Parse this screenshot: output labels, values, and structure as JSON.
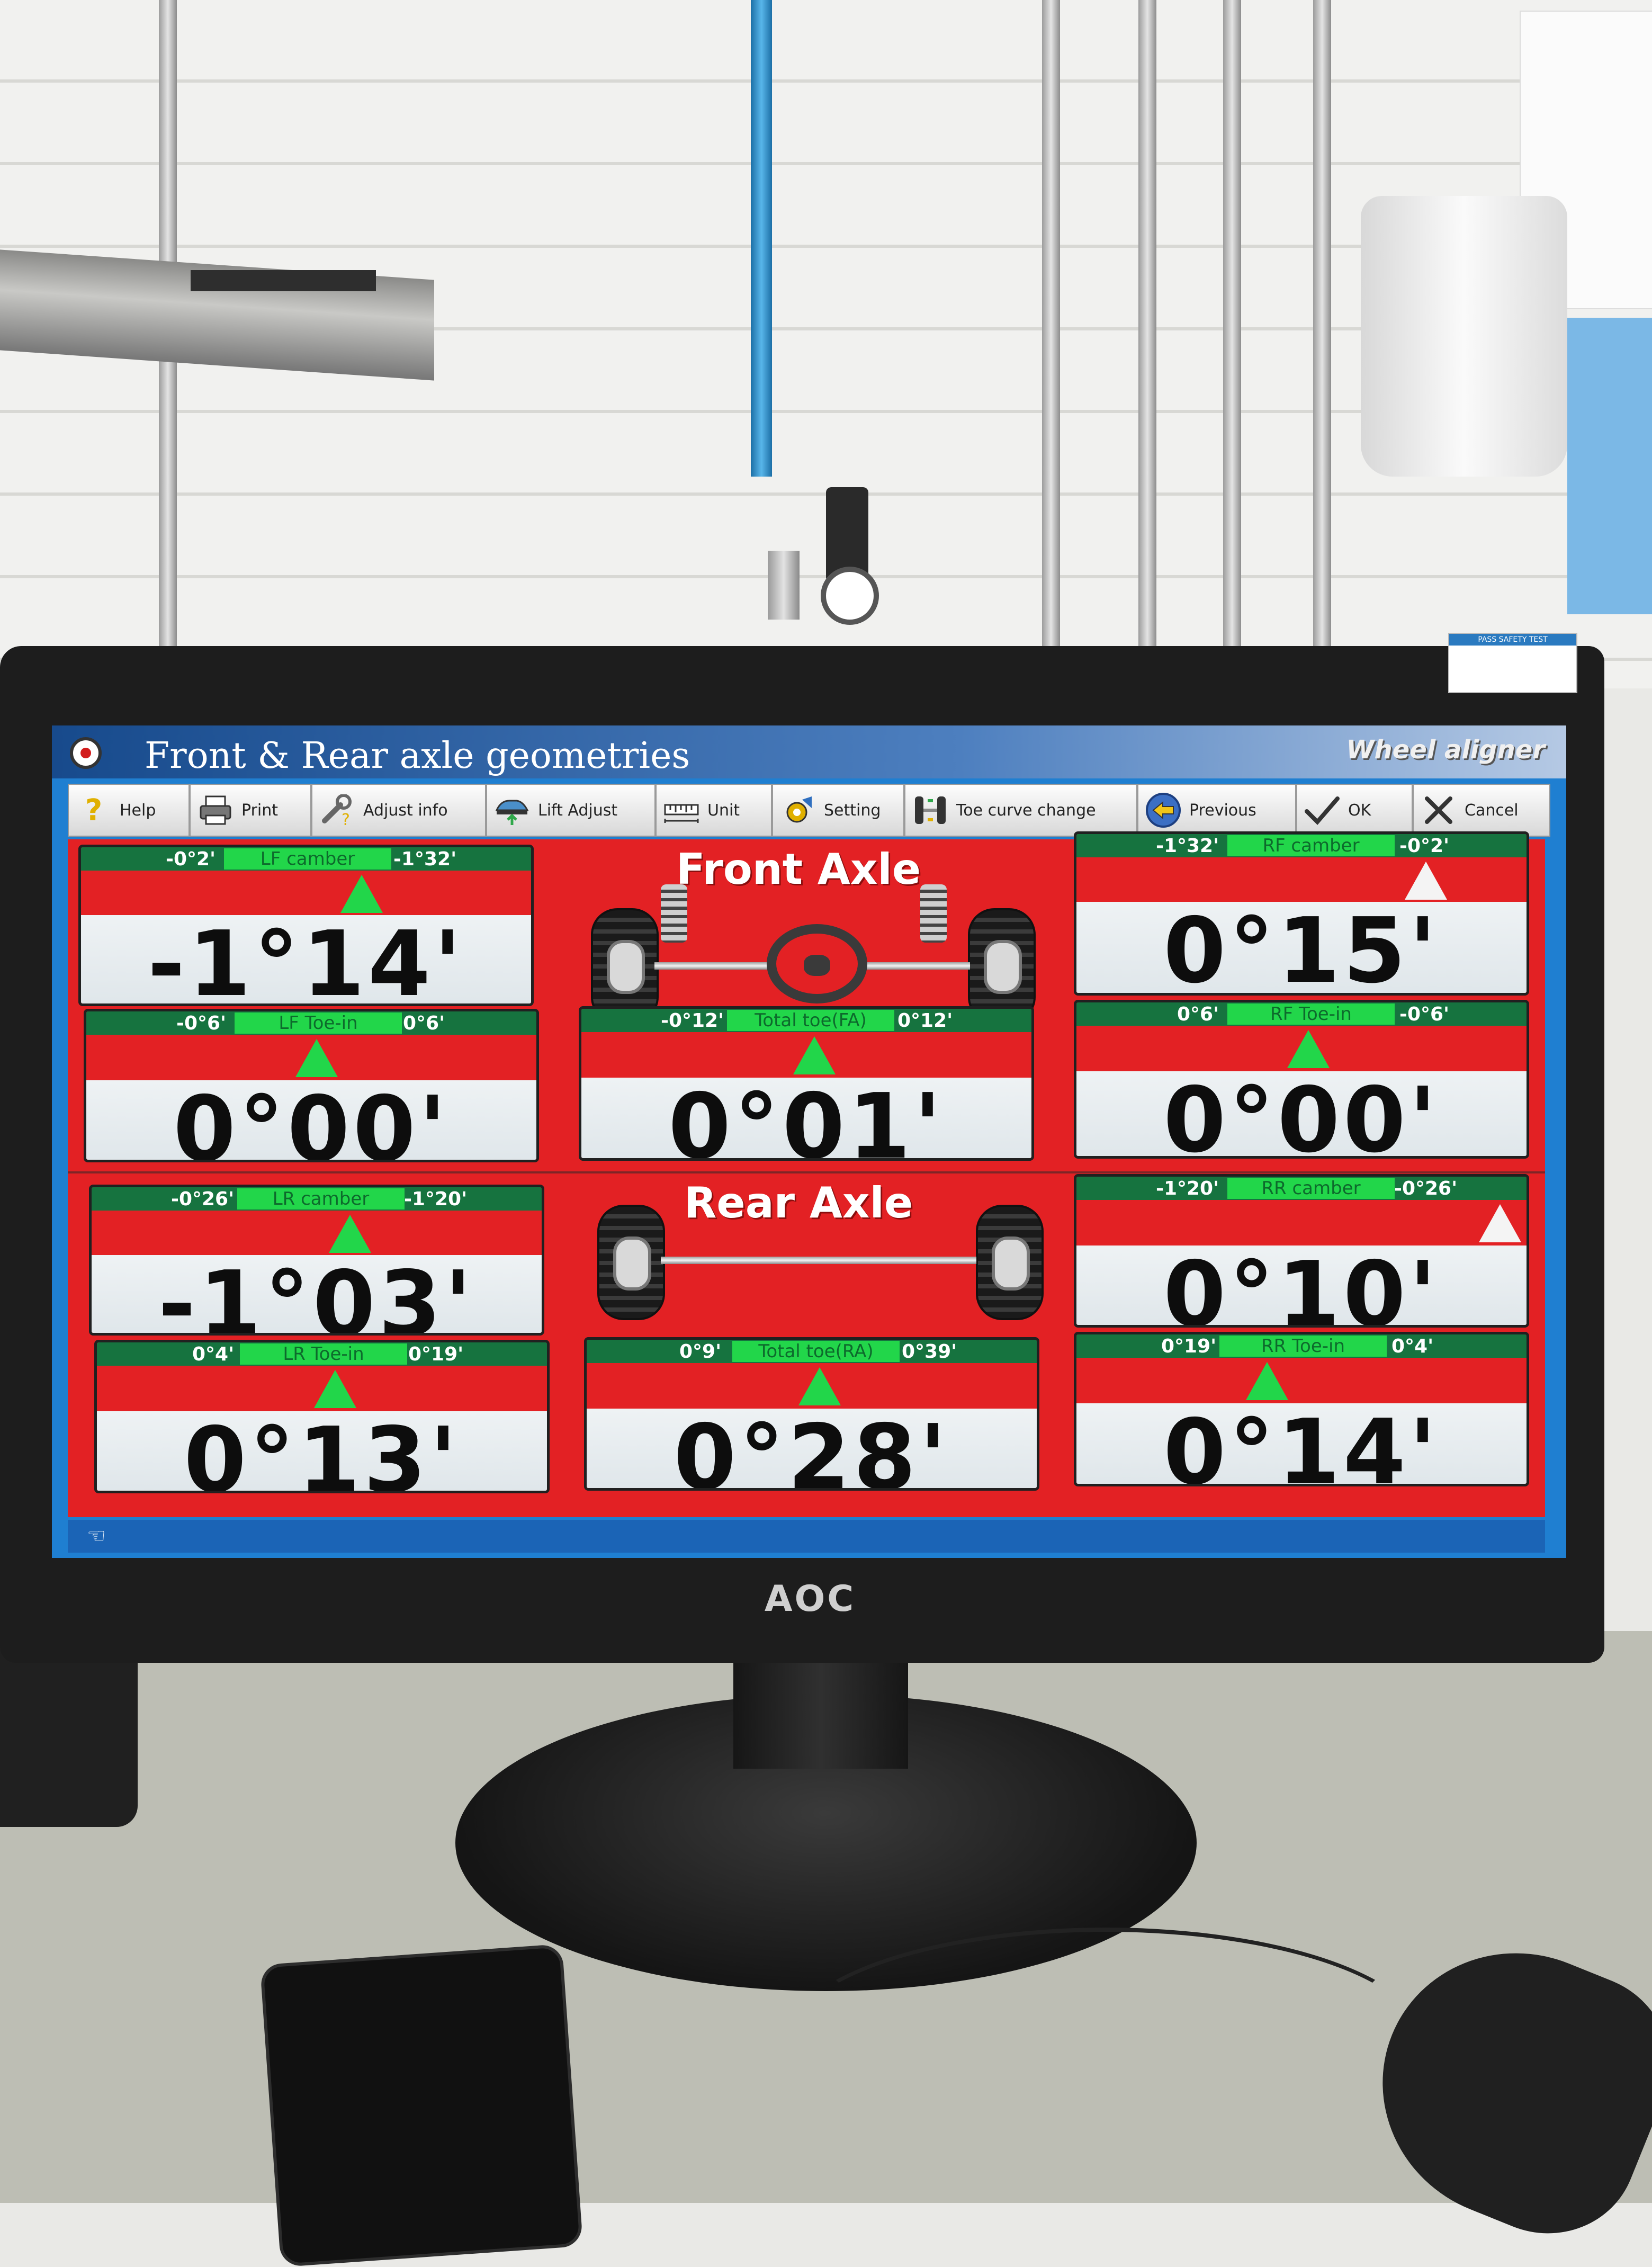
{
  "window": {
    "title": "Front & Rear axle geometries",
    "brand": "Wheel aligner"
  },
  "toolbar": [
    {
      "label": "Help",
      "icon": "help-icon"
    },
    {
      "label": "Print",
      "icon": "printer-icon"
    },
    {
      "label": "Adjust info",
      "icon": "wrench-icon"
    },
    {
      "label": "Lift Adjust",
      "icon": "car-lift-icon"
    },
    {
      "label": "Unit",
      "icon": "ruler-icon"
    },
    {
      "label": "Setting",
      "icon": "settings-icon"
    },
    {
      "label": "Toe curve change",
      "icon": "toe-curve-icon"
    },
    {
      "label": "Previous",
      "icon": "arrow-left-icon"
    },
    {
      "label": "OK",
      "icon": "checkmark-icon"
    },
    {
      "label": "Cancel",
      "icon": "cross-icon"
    }
  ],
  "front_axle": {
    "title": "Front Axle",
    "lf_camber": {
      "name": "LF camber",
      "min": "-0°2'",
      "max": "-1°32'",
      "value": "-1°14'"
    },
    "rf_camber": {
      "name": "RF camber",
      "min": "-1°32'",
      "max": "-0°2'",
      "value": "0°15'"
    },
    "lf_toe": {
      "name": "LF Toe-in",
      "min": "-0°6'",
      "max": "0°6'",
      "value": "0°00'"
    },
    "total_toe": {
      "name": "Total toe(FA)",
      "min": "-0°12'",
      "max": "0°12'",
      "value": "0°01'"
    },
    "rf_toe": {
      "name": "RF Toe-in",
      "min": "0°6'",
      "max": "-0°6'",
      "value": "0°00'"
    }
  },
  "rear_axle": {
    "title": "Rear Axle",
    "lr_camber": {
      "name": "LR camber",
      "min": "-0°26'",
      "max": "-1°20'",
      "value": "-1°03'"
    },
    "rr_camber": {
      "name": "RR camber",
      "min": "-1°20'",
      "max": "-0°26'",
      "value": "0°10'"
    },
    "lr_toe": {
      "name": "LR Toe-in",
      "min": "0°4'",
      "max": "0°19'",
      "value": "0°13'"
    },
    "total_toe": {
      "name": "Total toe(RA)",
      "min": "0°9'",
      "max": "0°39'",
      "value": "0°28'"
    },
    "rr_toe": {
      "name": "RR Toe-in",
      "min": "0°19'",
      "max": "0°4'",
      "value": "0°14'"
    }
  },
  "colors": {
    "in_range": "#22d64a",
    "out_of_range": "#f4f4f4",
    "background": "#e32124"
  },
  "monitor_brand": "AOC"
}
